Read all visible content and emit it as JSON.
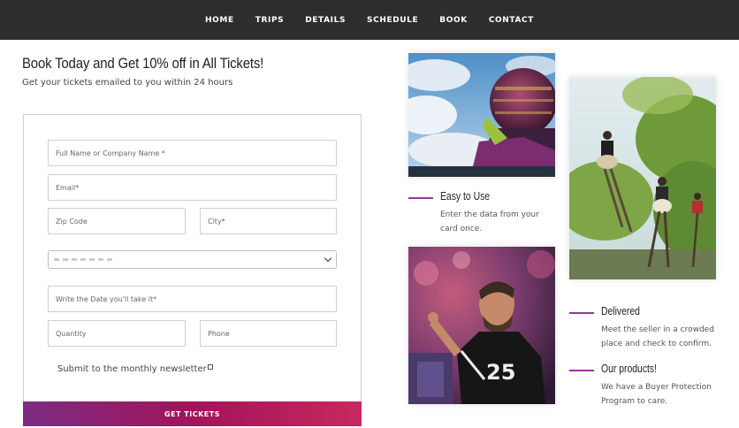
{
  "nav": {
    "items": [
      "HOME",
      "TRIPS",
      "DETAILS",
      "SCHEDULE",
      "BOOK",
      "CONTACT"
    ]
  },
  "headline": "Book Today and Get 10% off in All Tickets!",
  "subline": "Get your tickets emailed to you within 24 hours",
  "form": {
    "name_placeholder": "Full Name or Company Name *",
    "email_placeholder": "Email*",
    "zip_placeholder": "Zip Code",
    "city_placeholder": "City*",
    "date_placeholder": "Write the Date you'll take it*",
    "quantity_placeholder": "Quantity",
    "phone_placeholder": "Phone",
    "newsletter_label": "Submit to the monthly newsletter",
    "submit_label": "GET TICKETS"
  },
  "features": [
    {
      "title": "Easy to Use",
      "text": "Enter the data from your card once."
    },
    {
      "title": "Delivered",
      "text": "Meet the seller in a crowded place and check to confirm."
    },
    {
      "title": "Our products!",
      "text": "We have a Buyer Protection Program to care."
    }
  ],
  "colors": {
    "accent": "#8e3a9a",
    "nav_bg": "#2e2e2e",
    "button_start": "#7b2d83",
    "button_end": "#c8285e"
  }
}
